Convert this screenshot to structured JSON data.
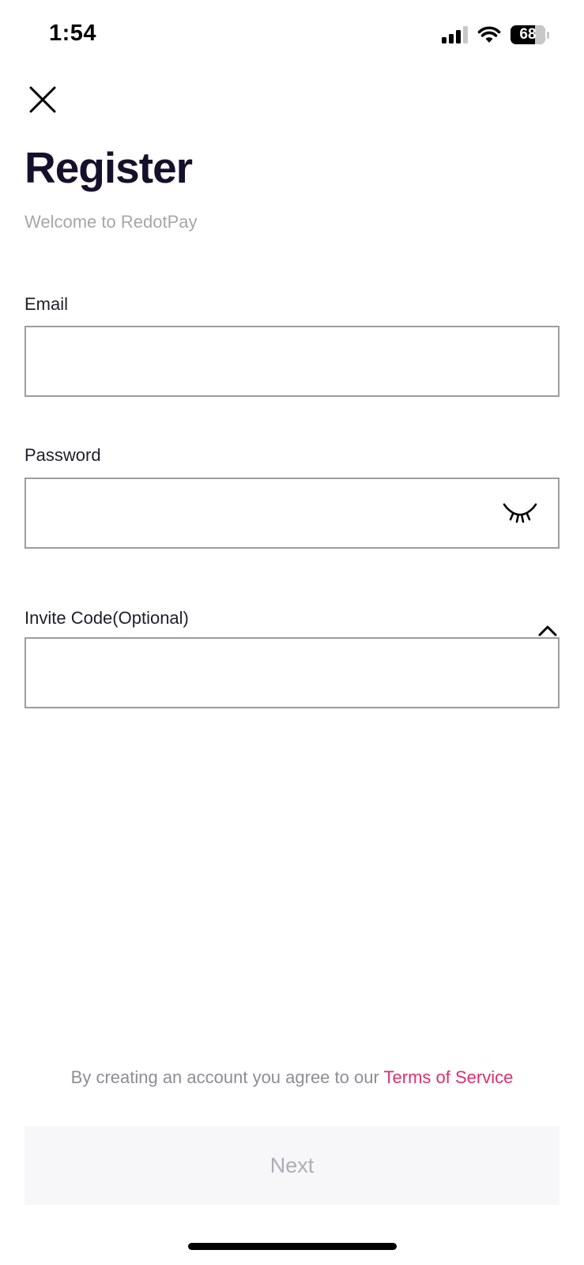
{
  "status_bar": {
    "time": "1:54",
    "battery": "68",
    "icons": [
      "signal-icon",
      "wifi-icon",
      "battery-icon"
    ]
  },
  "header": {
    "close_icon": "close-icon",
    "title": "Register",
    "subtitle": "Welcome to RedotPay"
  },
  "form": {
    "email": {
      "label": "Email",
      "value": "",
      "placeholder": ""
    },
    "password": {
      "label": "Password",
      "value": "",
      "placeholder": "",
      "toggle_icon": "eye-closed-icon"
    },
    "invite_code": {
      "label": "Invite Code(Optional)",
      "value": "",
      "placeholder": "",
      "toggle_icon": "chevron-up-icon"
    }
  },
  "footer": {
    "terms_prefix": "By creating an account you agree to our ",
    "terms_link": "Terms of Service",
    "next_label": "Next"
  },
  "colors": {
    "title": "#16102a",
    "subtitle": "#a6a6ad",
    "link": "#de2f6a",
    "input_border": "#9c9ca2",
    "button_bg_disabled": "#f7f7f9",
    "button_text_disabled": "#aeaeb4"
  }
}
